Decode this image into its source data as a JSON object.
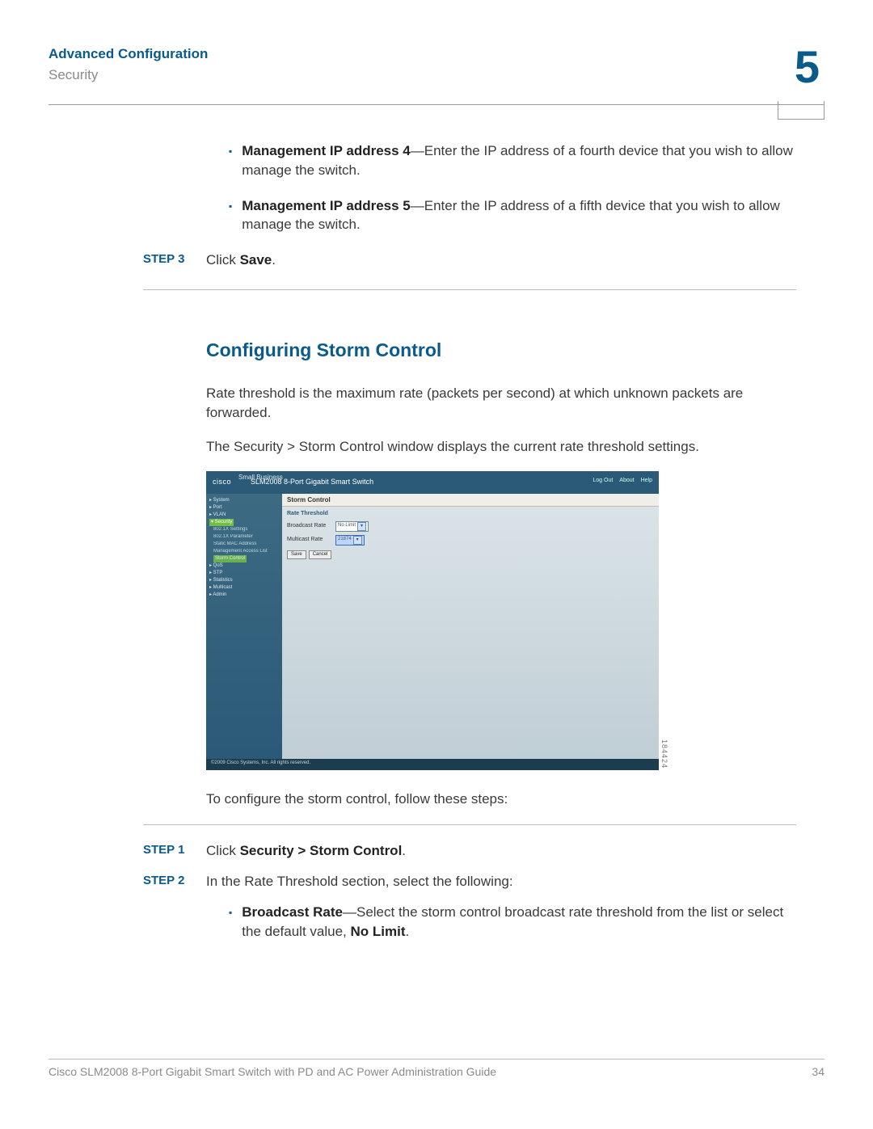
{
  "header": {
    "title": "Advanced Configuration",
    "section": "Security",
    "chapter": "5"
  },
  "bullets": [
    {
      "label": "Management IP address 4",
      "text": "—Enter the IP address of a fourth device that you wish to allow manage the switch."
    },
    {
      "label": "Management IP address 5",
      "text": "—Enter the IP address of a fifth device that you wish to allow manage the switch."
    }
  ],
  "step3": {
    "label": "STEP 3",
    "prefix": "Click ",
    "bold": "Save",
    "suffix": "."
  },
  "h2": "Configuring Storm Control",
  "para1": "Rate threshold is the maximum rate (packets per second) at which unknown packets are forwarded.",
  "para2": "The Security > Storm Control window displays the current rate threshold settings.",
  "shot": {
    "brand_top": "Small Business",
    "brand": "cisco",
    "product": "SLM2008 8-Port Gigabit Smart Switch",
    "links": [
      "Log Out",
      "About",
      "Help"
    ],
    "nav": [
      {
        "t": "▸ System",
        "c": "h"
      },
      {
        "t": "▸ Port",
        "c": "h"
      },
      {
        "t": "▸ VLAN",
        "c": "h"
      },
      {
        "t": "▾ Security",
        "c": "sel"
      },
      {
        "t": "802.1X Settings",
        "c": "i"
      },
      {
        "t": "802.1X Parameter",
        "c": "i"
      },
      {
        "t": "Static MAC Address",
        "c": "i"
      },
      {
        "t": "Management Access List",
        "c": "i"
      },
      {
        "t": "Storm Control",
        "c": "sel"
      },
      {
        "t": "▸ QoS",
        "c": "h"
      },
      {
        "t": "▸ STP",
        "c": "h"
      },
      {
        "t": "▸ Statistics",
        "c": "h"
      },
      {
        "t": "▸ Multicast",
        "c": "h"
      },
      {
        "t": "▸ Admin",
        "c": "h"
      }
    ],
    "panel_title": "Storm Control",
    "panel_sub": "Rate Threshold",
    "rows": [
      {
        "lbl": "Broadcast Rate",
        "val": "No Limit",
        "hl": false
      },
      {
        "lbl": "Multicast Rate",
        "val": "21874",
        "hl": true
      }
    ],
    "buttons": [
      "Save",
      "Cancel"
    ],
    "copyright": "©2009 Cisco Systems, Inc. All rights reserved.",
    "side_num": "184424"
  },
  "para3": "To configure the storm control, follow these steps:",
  "step1": {
    "label": "STEP 1",
    "prefix": "Click ",
    "bold": "Security > Storm Control",
    "suffix": "."
  },
  "step2": {
    "label": "STEP 2",
    "text": "In the Rate Threshold section, select the following:"
  },
  "sub_bullet": {
    "label": "Broadcast Rate",
    "text": "—Select the storm control broadcast rate threshold from the list or select the default value, ",
    "bold2": "No Limit",
    "suffix": "."
  },
  "footer": {
    "doc": "Cisco SLM2008 8-Port Gigabit Smart Switch with PD and AC Power Administration Guide",
    "page": "34"
  }
}
